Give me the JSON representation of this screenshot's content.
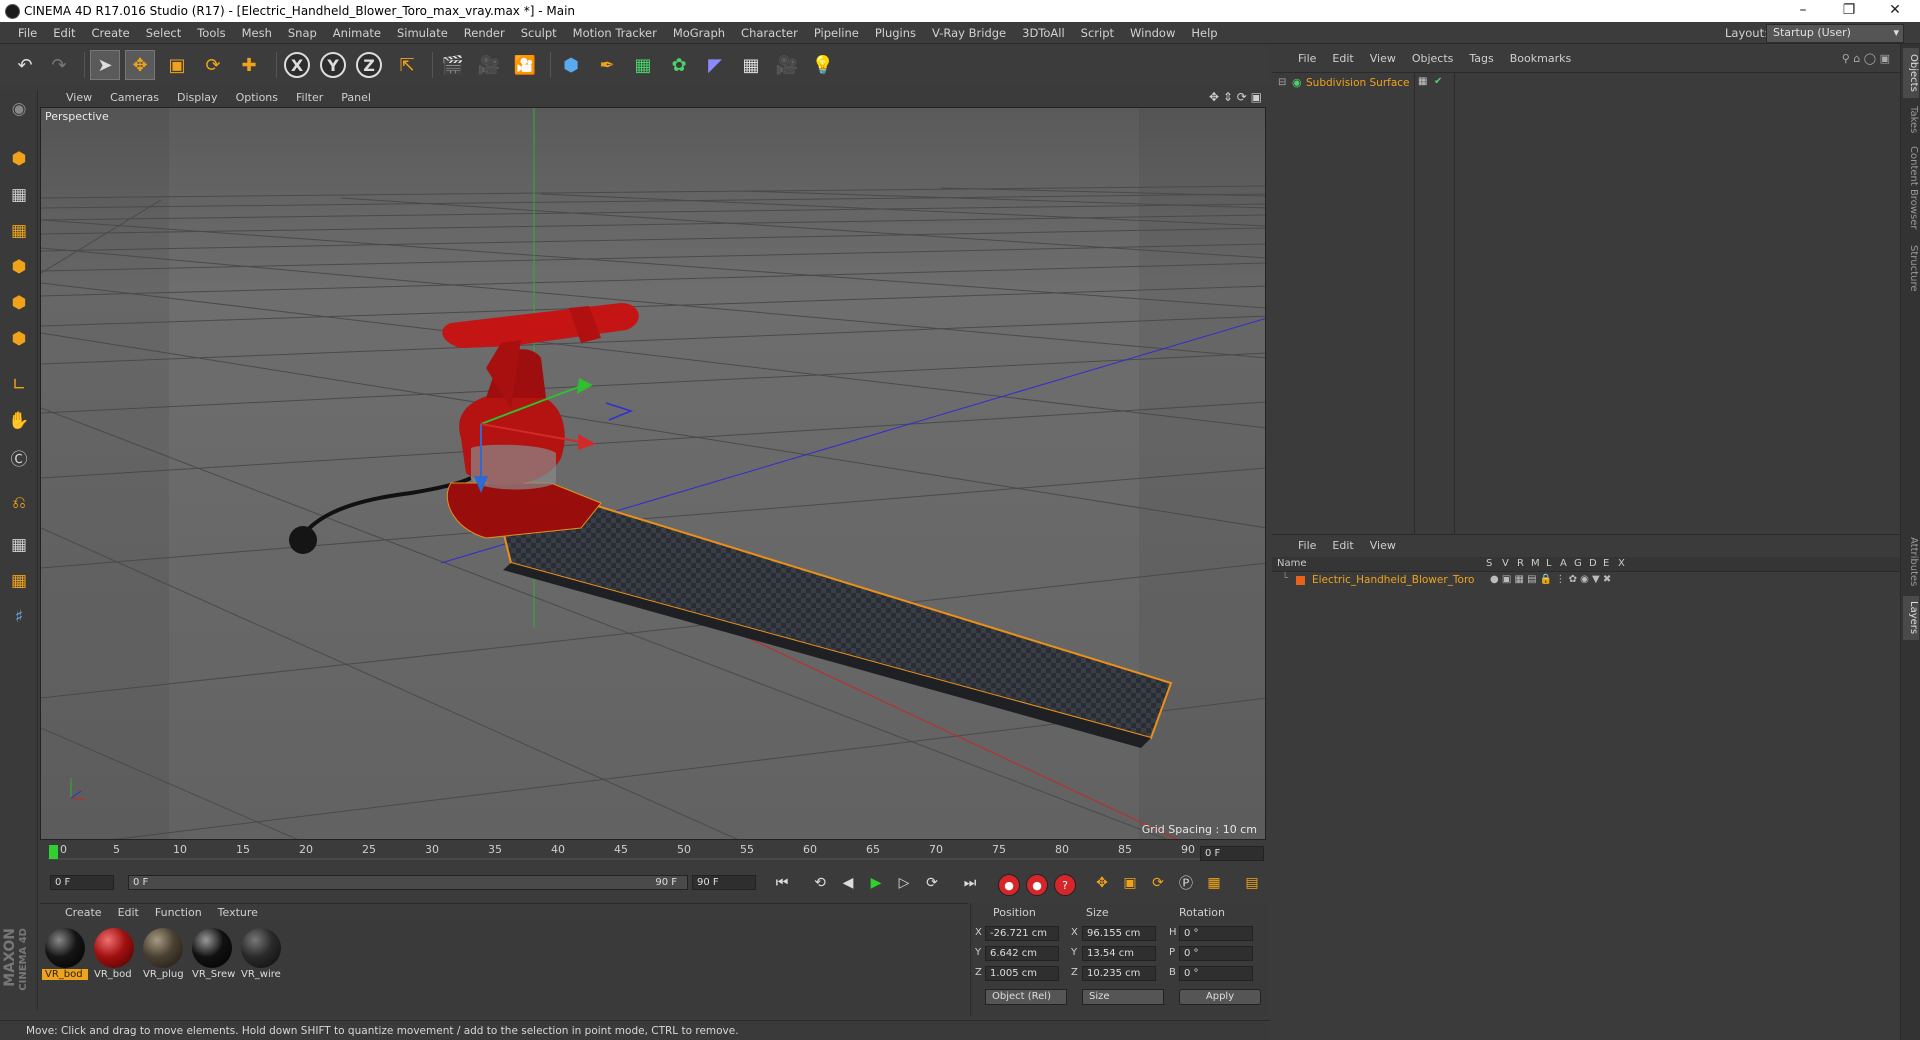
{
  "window": {
    "title": "CINEMA 4D R17.016 Studio (R17) - [Electric_Handheld_Blower_Toro_max_vray.max *] - Main",
    "controls": [
      "minimize-icon",
      "restore-icon",
      "close-icon"
    ]
  },
  "menu": [
    "File",
    "Edit",
    "Create",
    "Select",
    "Tools",
    "Mesh",
    "Snap",
    "Animate",
    "Simulate",
    "Render",
    "Sculpt",
    "Motion Tracker",
    "MoGraph",
    "Character",
    "Pipeline",
    "Plugins",
    "V-Ray Bridge",
    "3DToAll",
    "Script",
    "Window",
    "Help"
  ],
  "layout": {
    "label": "Layout:",
    "value": "Startup (User)"
  },
  "toolbar": {
    "x_label": "X",
    "y_label": "Y",
    "z_label": "Z"
  },
  "viewport": {
    "menu": [
      "View",
      "Cameras",
      "Display",
      "Options",
      "Filter",
      "Panel"
    ],
    "name": "Perspective",
    "grid_spacing": "Grid Spacing : 10 cm"
  },
  "timeline": {
    "ticks": [
      "0",
      "5",
      "10",
      "15",
      "20",
      "25",
      "30",
      "35",
      "40",
      "45",
      "50",
      "55",
      "60",
      "65",
      "70",
      "75",
      "80",
      "85",
      "90"
    ],
    "current_frame": "0 F"
  },
  "playback": {
    "start": "0 F",
    "range_start": "0 F",
    "range_end": "90 F",
    "end": "90 F"
  },
  "materials": {
    "menu": [
      "Create",
      "Edit",
      "Function",
      "Texture"
    ],
    "items": [
      {
        "label": "VR_bod",
        "color": "#151515"
      },
      {
        "label": "VR_bod",
        "color": "#a01010"
      },
      {
        "label": "VR_plug",
        "color": "#4a4032"
      },
      {
        "label": "VR_Srew",
        "color": "#111111"
      },
      {
        "label": "VR_wire",
        "color": "#2a2a2a"
      }
    ]
  },
  "coordinates": {
    "headers": {
      "position": "Position",
      "size": "Size",
      "rotation": "Rotation"
    },
    "rows": [
      {
        "axis": "X",
        "pos": "-26.721 cm",
        "size_axis": "X",
        "size": "96.155 cm",
        "rot_axis": "H",
        "rot": "0 °"
      },
      {
        "axis": "Y",
        "pos": "6.642 cm",
        "size_axis": "Y",
        "size": "13.54 cm",
        "rot_axis": "P",
        "rot": "0 °"
      },
      {
        "axis": "Z",
        "pos": "1.005 cm",
        "size_axis": "Z",
        "size": "10.235 cm",
        "rot_axis": "B",
        "rot": "0 °"
      }
    ],
    "mode": "Object (Rel)",
    "size_mode": "Size",
    "apply": "Apply"
  },
  "status": "Move: Click and drag to move elements. Hold down SHIFT to quantize movement / add to the selection in point mode, CTRL to remove.",
  "object_manager": {
    "menu": [
      "File",
      "Edit",
      "View",
      "Objects",
      "Tags",
      "Bookmarks"
    ],
    "object": "Subdivision Surface"
  },
  "layer_manager": {
    "menu": [
      "File",
      "Edit",
      "View"
    ],
    "name_header": "Name",
    "flags": [
      "S",
      "V",
      "R",
      "M",
      "L",
      "A",
      "G",
      "D",
      "E",
      "X"
    ],
    "layer": "Electric_Handheld_Blower_Toro",
    "layer_color": "#e8621a"
  },
  "side_tabs": [
    "Objects",
    "Takes",
    "Content Browser",
    "Structure",
    "Attributes",
    "Layers"
  ],
  "brand": {
    "line1": "MAXON",
    "line2": "CINEMA 4D"
  },
  "colors": {
    "accent": "#f0a31a",
    "background": "#3b3b3b"
  }
}
